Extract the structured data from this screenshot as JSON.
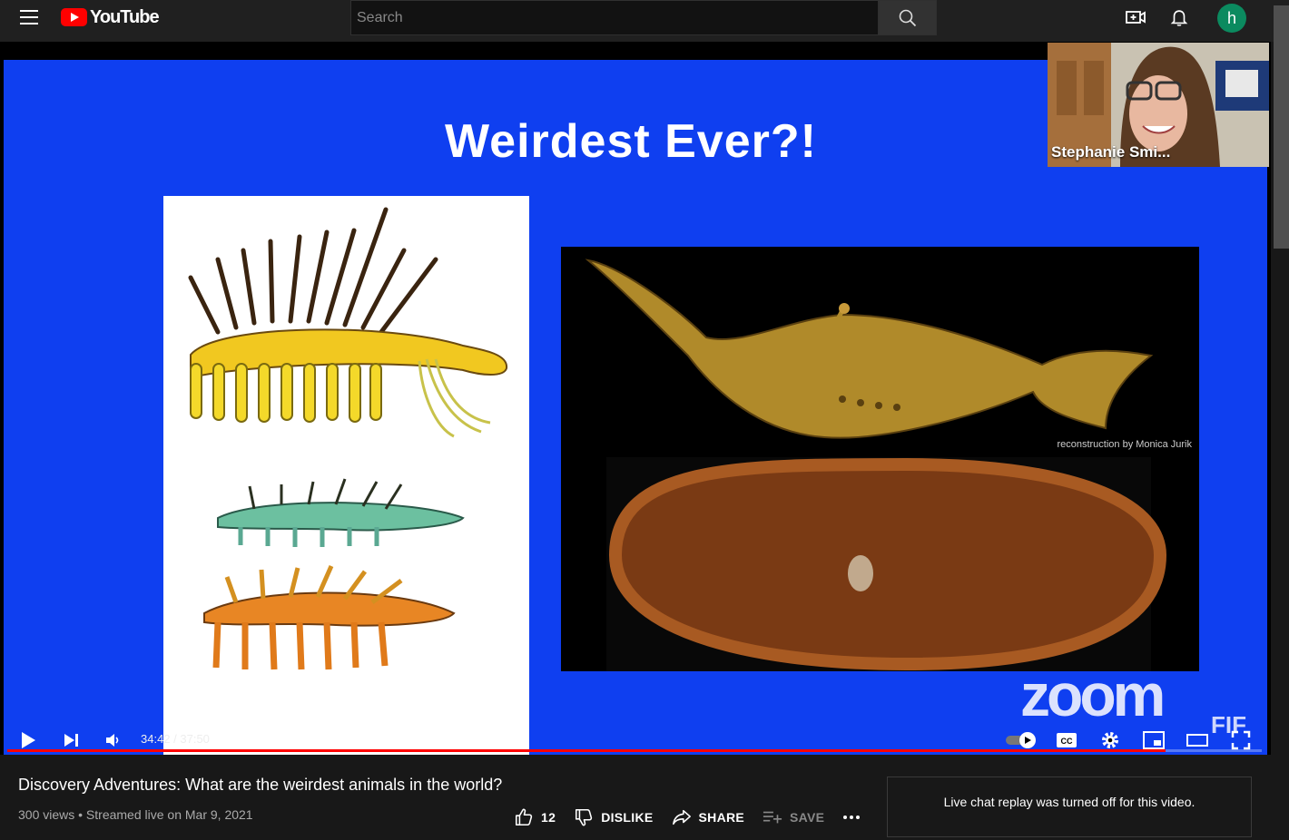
{
  "header": {
    "logo_text": "YouTube",
    "search_placeholder": "Search",
    "avatar_letter": "h"
  },
  "slide": {
    "title": "Weirdest Ever?!",
    "credit": "reconstruction by Monica Jurik",
    "zoom_watermark": "zoom",
    "fif_watermark": "FIF"
  },
  "webcam": {
    "participant_name": "Stephanie Smi..."
  },
  "player": {
    "time": "34:42 / 37:50",
    "progress_fraction": 0.923
  },
  "video": {
    "title": "Discovery Adventures: What are the weirdest animals in the world?",
    "meta": "300 views • Streamed live on Mar 9, 2021",
    "like_count": "12",
    "dislike_label": "DISLIKE",
    "share_label": "SHARE",
    "save_label": "SAVE"
  },
  "chat": {
    "message": "Live chat replay was turned off for this video."
  },
  "colors": {
    "slide_blue": "#0f3ff0",
    "brand_red": "#ff0000",
    "avatar_green": "#0b8a5f"
  }
}
